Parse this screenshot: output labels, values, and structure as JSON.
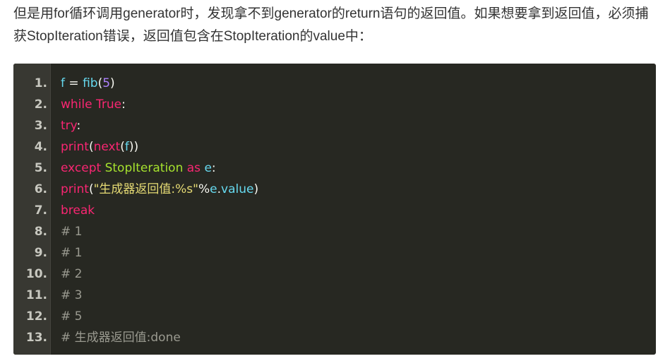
{
  "paragraph": "但是用for循环调用generator时，发现拿不到generator的return语句的返回值。如果想要拿到返回值，必须捕获StopIteration错误，返回值包含在StopIteration的value中：",
  "code_lines": [
    {
      "num": "1.",
      "tokens": [
        [
          "f",
          "f"
        ],
        [
          " = ",
          "p"
        ],
        [
          "fib",
          "f"
        ],
        [
          "(",
          "p"
        ],
        [
          "5",
          "n"
        ],
        [
          ")",
          "p"
        ]
      ]
    },
    {
      "num": "2.",
      "tokens": [
        [
          "while",
          "k"
        ],
        [
          " ",
          "p"
        ],
        [
          "True",
          "k"
        ],
        [
          ":",
          "p"
        ]
      ]
    },
    {
      "num": "3.",
      "tokens": [
        [
          "try",
          "k"
        ],
        [
          ":",
          "p"
        ]
      ]
    },
    {
      "num": "4.",
      "tokens": [
        [
          "print",
          "k"
        ],
        [
          "(",
          "p"
        ],
        [
          "next",
          "k"
        ],
        [
          "(",
          "p"
        ],
        [
          "f",
          "f"
        ],
        [
          "))",
          "p"
        ]
      ]
    },
    {
      "num": "5.",
      "tokens": [
        [
          "except",
          "k"
        ],
        [
          " ",
          "p"
        ],
        [
          "StopIteration",
          "c"
        ],
        [
          " ",
          "p"
        ],
        [
          "as",
          "k"
        ],
        [
          " ",
          "p"
        ],
        [
          "e",
          "f"
        ],
        [
          ":",
          "p"
        ]
      ]
    },
    {
      "num": "6.",
      "tokens": [
        [
          "print",
          "k"
        ],
        [
          "(",
          "p"
        ],
        [
          "\"生成器返回值:%s\"",
          "s"
        ],
        [
          "%",
          "p"
        ],
        [
          "e",
          "f"
        ],
        [
          ".",
          "p"
        ],
        [
          "value",
          "f"
        ],
        [
          ")",
          "p"
        ]
      ]
    },
    {
      "num": "7.",
      "tokens": [
        [
          "break",
          "k"
        ]
      ]
    },
    {
      "num": "8.",
      "tokens": [
        [
          "# 1",
          "cm"
        ]
      ]
    },
    {
      "num": "9.",
      "tokens": [
        [
          "# 1",
          "cm"
        ]
      ]
    },
    {
      "num": "10.",
      "tokens": [
        [
          "# 2",
          "cm"
        ]
      ]
    },
    {
      "num": "11.",
      "tokens": [
        [
          "# 3",
          "cm"
        ]
      ]
    },
    {
      "num": "12.",
      "tokens": [
        [
          "# 5",
          "cm"
        ]
      ]
    },
    {
      "num": "13.",
      "tokens": [
        [
          "# 生成器返回值:done",
          "cm"
        ]
      ]
    }
  ]
}
